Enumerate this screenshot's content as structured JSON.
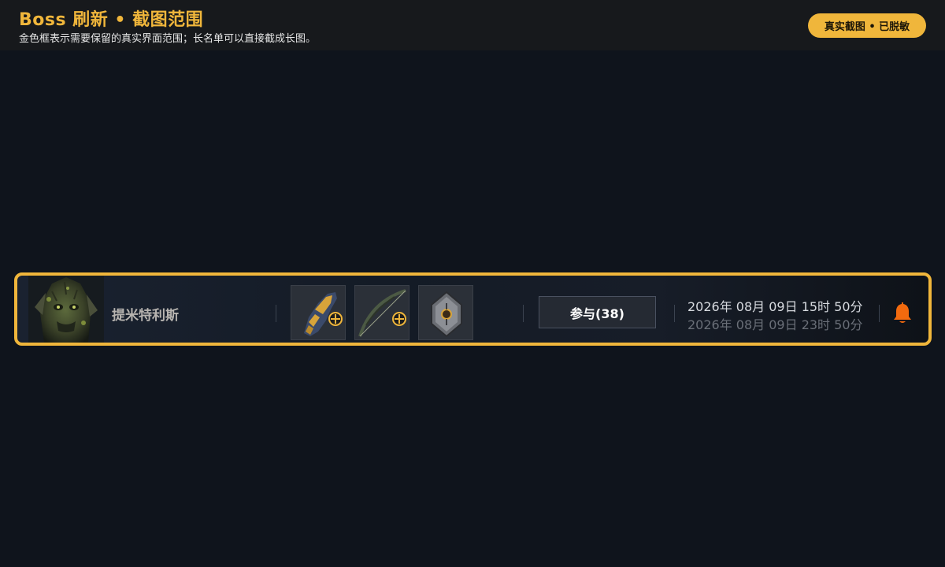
{
  "header": {
    "title": "Boss 刷新 • 截图范围",
    "subtitle": "金色框表示需要保留的真实界面范围；长名单可以直接截成长图。",
    "badge": "真实截图 • 已脱敏"
  },
  "boss_row": {
    "boss_name": "提米特利斯",
    "drops": [
      {
        "name": "gauntlet-item",
        "has_badge": true
      },
      {
        "name": "bow-item",
        "has_badge": true
      },
      {
        "name": "shield-item",
        "has_badge": false
      }
    ],
    "join_label": "参与(38)",
    "time_start": "2026年 08月 09日 15时 50分",
    "time_end": "2026年 08月 09日 23时 50分"
  },
  "colors": {
    "accent": "#f0b63b",
    "bell": "#f26a0e",
    "background": "#0f141c"
  }
}
